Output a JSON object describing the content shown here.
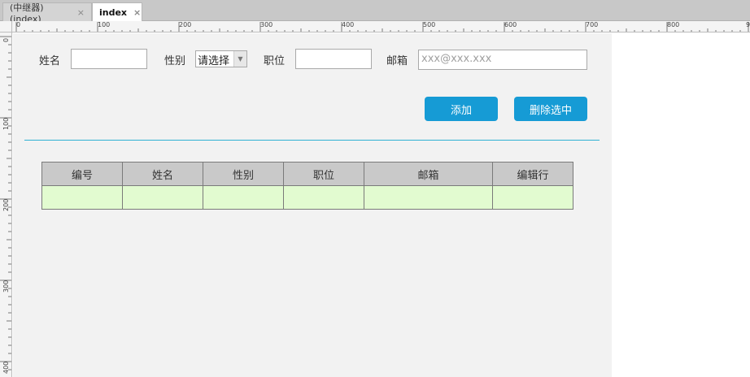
{
  "tabs": [
    {
      "label": "(中继器) (index)",
      "close": "×"
    },
    {
      "label": "index",
      "close": "×"
    }
  ],
  "ruler": {
    "top_labels": [
      "0",
      "100",
      "200",
      "300",
      "400",
      "500",
      "600",
      "700",
      "800",
      "9"
    ],
    "left_labels": [
      "0",
      "100",
      "200",
      "300",
      "400"
    ]
  },
  "form": {
    "name_label": "姓名",
    "name_value": "",
    "gender_label": "性别",
    "gender_selected": "请选择",
    "position_label": "职位",
    "position_value": "",
    "email_label": "邮箱",
    "email_placeholder": "xxx@xxx.xxx"
  },
  "buttons": {
    "add": "添加",
    "delete_selected": "删除选中"
  },
  "table": {
    "headers": [
      "编号",
      "姓名",
      "性别",
      "职位",
      "邮箱",
      "编辑行"
    ],
    "rows": [
      [
        "",
        "",
        "",
        "",
        "",
        ""
      ]
    ]
  },
  "colors": {
    "button": "#169bd5",
    "divider": "#2fb1d3",
    "header_bg": "#c9c9c9",
    "row_bg": "#e2fbd0",
    "canvas_bg": "#f2f2f2"
  }
}
